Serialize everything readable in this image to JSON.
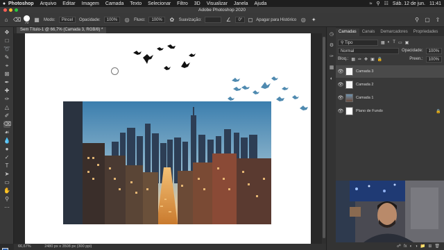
{
  "menubar": {
    "apple": "",
    "app": "Photoshop",
    "items": [
      "Arquivo",
      "Editar",
      "Imagem",
      "Camada",
      "Texto",
      "Selecionar",
      "Filtro",
      "3D",
      "Visualizar",
      "Janela",
      "Ajuda"
    ],
    "date": "Sáb. 12 de jun.",
    "time": "11:41"
  },
  "window": {
    "title": "Adobe Photoshop 2020"
  },
  "options": {
    "brush_size": "70",
    "mode_label": "Modo:",
    "mode_value": "Pincel",
    "opacity_label": "Opacidade:",
    "opacity_value": "100%",
    "flow_label": "Fluxo:",
    "flow_value": "100%",
    "smoothing_label": "Suavização:",
    "angle_value": "0°",
    "erase_history_label": "Apagar para Histórico"
  },
  "document": {
    "tab_label": "Sem Título-1 @ 66,7% (Camada 3, RGB/8) *"
  },
  "status": {
    "zoom": "66,67%",
    "doc_info": "2480 px x 3508 px (300 ppi)"
  },
  "layers_panel": {
    "tabs": [
      "Camadas",
      "Canais",
      "Demarcadores",
      "Propriedades"
    ],
    "filter_label": "Tipo",
    "blend_mode": "Normal",
    "opacity_label": "Opacidade:",
    "opacity_value": "100%",
    "lock_label": "Bloq.:",
    "fill_label": "Preen.:",
    "fill_value": "100%",
    "layers": [
      {
        "name": "Camada 3",
        "selected": true
      },
      {
        "name": "Camada 2",
        "selected": false
      },
      {
        "name": "Camada 1",
        "selected": false
      },
      {
        "name": "Plano de Fundo",
        "selected": false
      }
    ]
  },
  "colors": {
    "foreground": "#2a5ea8",
    "background": "#ffffff",
    "bird_black": "#111111",
    "bird_blue": "#4f8ab0"
  }
}
